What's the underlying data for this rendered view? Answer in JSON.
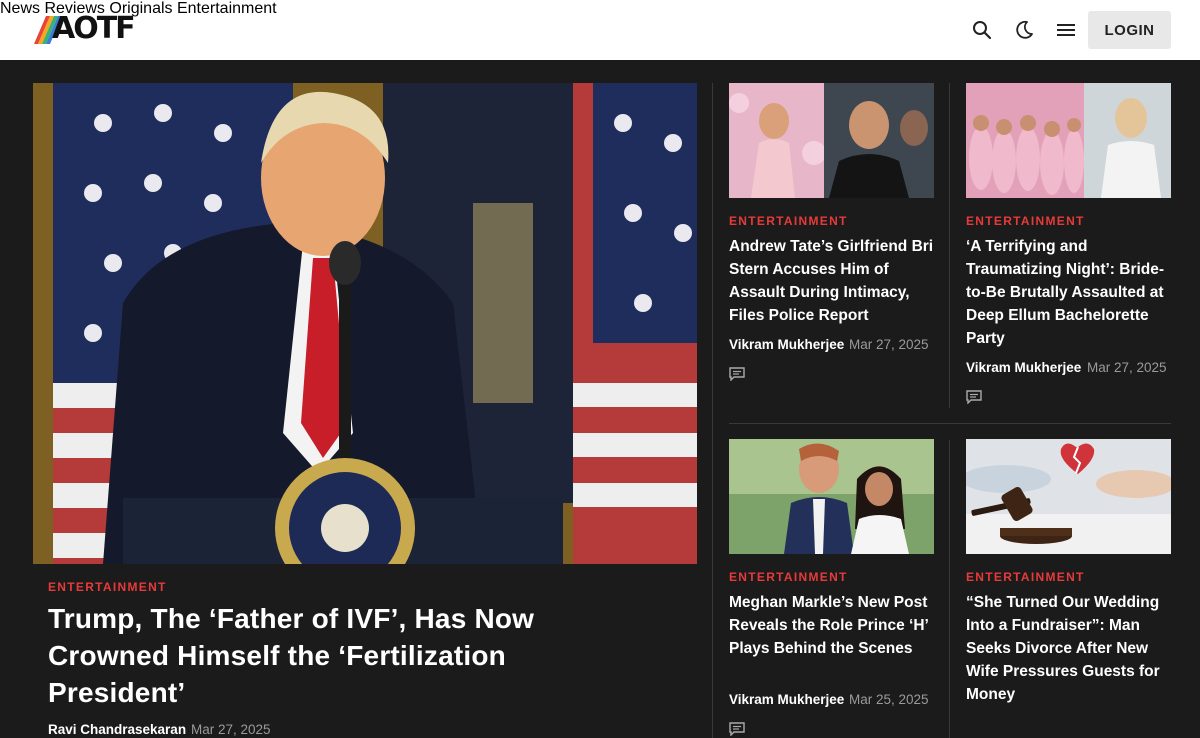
{
  "header": {
    "logo_text": "AOTF",
    "nav": [
      "News",
      "Reviews",
      "Originals",
      "Entertainment"
    ],
    "login_label": "LOGIN",
    "icons": [
      "search-icon",
      "dark-mode-icon",
      "menu-icon"
    ]
  },
  "hero": {
    "category": "ENTERTAINMENT",
    "title": "Trump, The ‘Father of IVF’, Has Now Crowned Himself the ‘Fertilization President’",
    "author": "Ravi Chandrasekaran",
    "date": "Mar 27, 2025"
  },
  "cards": [
    {
      "category": "ENTERTAINMENT",
      "title": "Andrew Tate’s Girlfriend Bri Stern Accuses Him of Assault During Intimacy, Files Police Report",
      "author": "Vikram Mukherjee",
      "date": "Mar 27, 2025"
    },
    {
      "category": "ENTERTAINMENT",
      "title": "‘A Terrifying and Traumatizing Night’: Bride-to-Be Brutally Assaulted at Deep Ellum Bachelorette Party",
      "author": "Vikram Mukherjee",
      "date": "Mar 27, 2025"
    },
    {
      "category": "ENTERTAINMENT",
      "title": "Meghan Markle’s New Post Reveals the Role Prince ‘H’ Plays Behind the Scenes",
      "author": "Vikram Mukherjee",
      "date": "Mar 25, 2025"
    },
    {
      "category": "ENTERTAINMENT",
      "title": "“She Turned Our Wedding Into a Fundraiser”: Man Seeks Divorce After New Wife Pressures Guests for Money",
      "author": "",
      "date": ""
    }
  ],
  "colors": {
    "accent": "#e83a3a",
    "background": "#1b1b1b",
    "header": "#ffffff"
  }
}
